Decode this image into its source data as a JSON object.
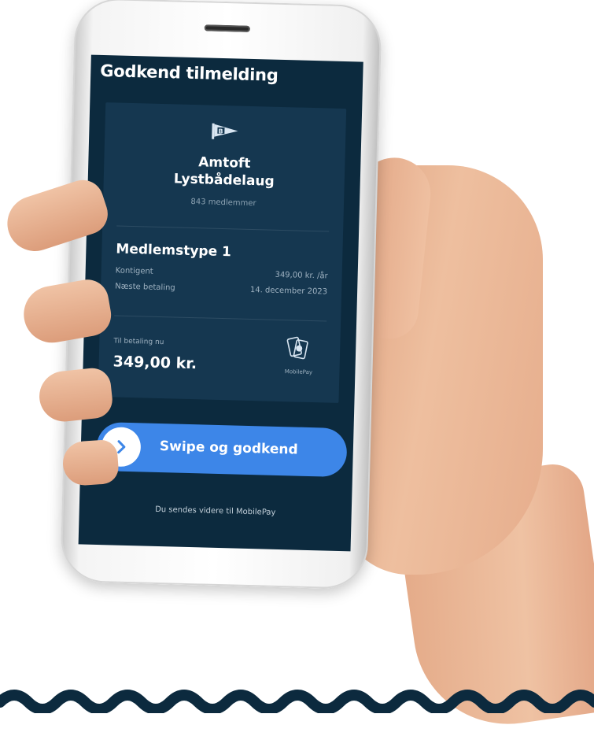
{
  "screen": {
    "title": "Godkend tilmelding",
    "club": {
      "name_line1": "Amtoft",
      "name_line2": "Lystbådelaug",
      "member_count": "843 medlemmer",
      "icon": "flag-icon"
    },
    "membership": {
      "type": "Medlemstype 1",
      "rows": [
        {
          "label": "Kontigent",
          "value": "349,00 kr. /år"
        },
        {
          "label": "Næste betaling",
          "value": "14. december 2023"
        }
      ]
    },
    "payment": {
      "label": "Til betaling nu",
      "amount": "349,00 kr.",
      "provider": "MobilePay",
      "provider_icon": "mobilepay-icon"
    },
    "swipe_button": {
      "label": "Swipe og godkend",
      "icon": "chevron-right-icon"
    },
    "redirect_note": "Du sendes videre til MobilePay"
  },
  "colors": {
    "screen_bg": "#0c2a3e",
    "card_bg": "#153750",
    "accent": "#3d86e8",
    "muted_text": "#9fb2c1"
  }
}
